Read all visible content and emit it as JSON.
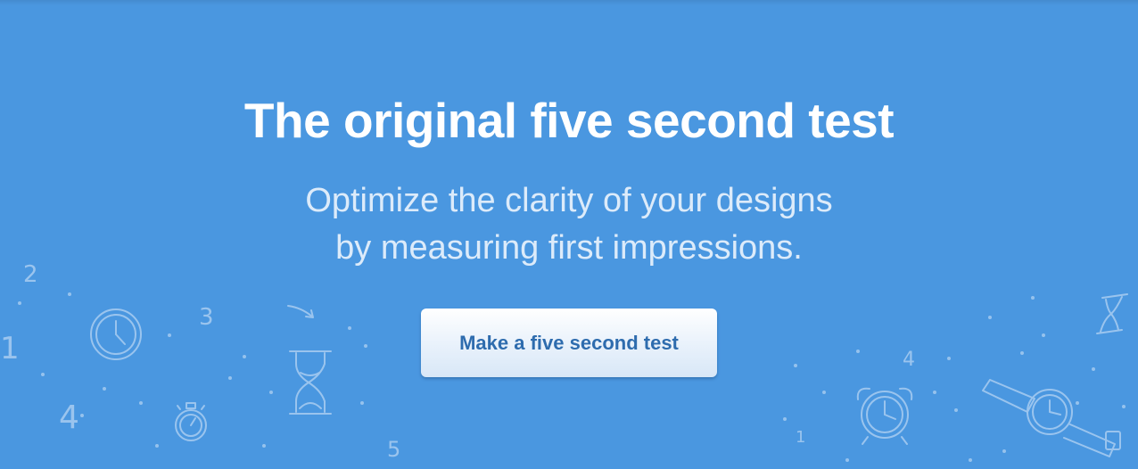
{
  "hero": {
    "title": "The original five second test",
    "subtitle": "Optimize the clarity of your designs by measuring first impressions.",
    "cta_label": "Make a five second test"
  },
  "doodles": {
    "numbers": [
      "2",
      "3",
      "1",
      "4",
      "5",
      "4",
      "1"
    ]
  },
  "colors": {
    "background": "#4a97e0",
    "title_text": "#ffffff",
    "subtitle_text": "#dcebfa",
    "button_text": "#2e6cae",
    "doodle_stroke": "#a9cdf1"
  }
}
